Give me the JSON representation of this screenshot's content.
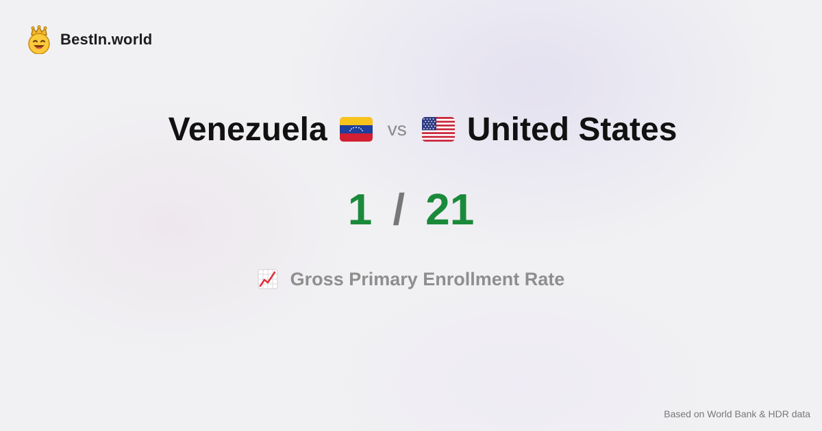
{
  "brand": {
    "name": "BestIn.world",
    "icon": "crown-smiley-icon"
  },
  "comparison": {
    "left_country": "Venezuela",
    "left_flag": "venezuela-flag-icon",
    "vs_label": "vs",
    "right_country": "United States",
    "right_flag": "usa-flag-icon"
  },
  "scores": {
    "left": "1",
    "separator": "/",
    "right": "21"
  },
  "metric": {
    "icon": "chart-increasing-icon",
    "label": "Gross Primary Enrollment Rate"
  },
  "footer": {
    "source": "Based on World Bank & HDR data"
  },
  "colors": {
    "score": "#1a8a3a",
    "separator": "#777777",
    "metric": "#8e8e8e"
  }
}
